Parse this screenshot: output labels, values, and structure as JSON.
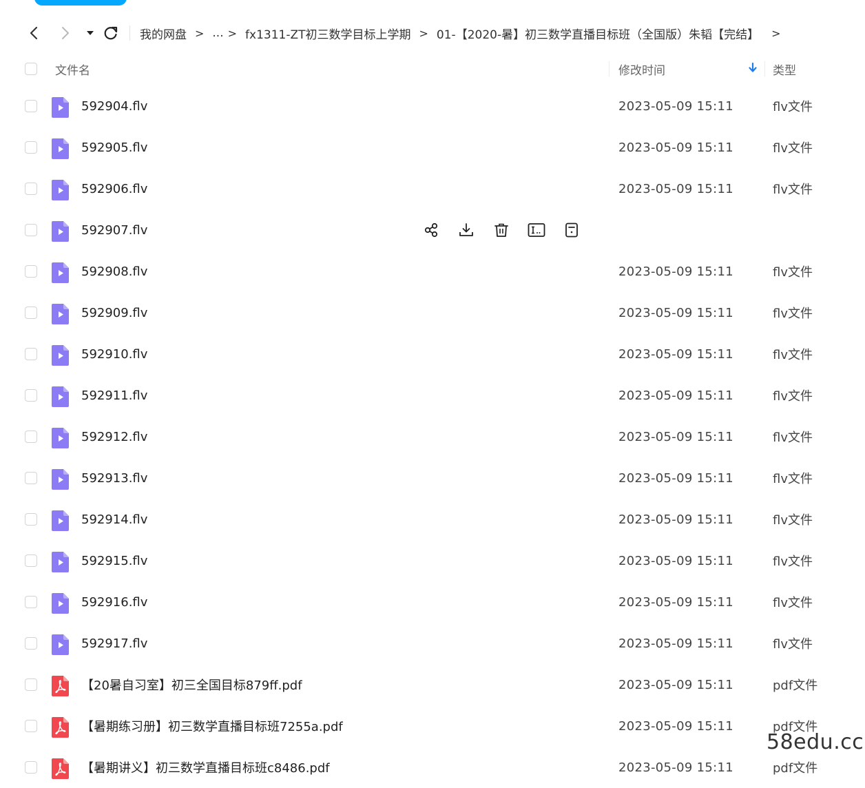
{
  "nav": {
    "breadcrumbs": [
      "我的网盘",
      "...",
      "fx1311-ZT初三数学目标上学期",
      "01-【2020-暑】初三数学直播目标班（全国版）朱韬【完结】"
    ]
  },
  "header": {
    "name_label": "文件名",
    "time_label": "修改时间",
    "type_label": "类型"
  },
  "files": [
    {
      "name": "592904.flv",
      "time": "2023-05-09 15:11",
      "type": "flv文件",
      "icon": "video-file-icon"
    },
    {
      "name": "592905.flv",
      "time": "2023-05-09 15:11",
      "type": "flv文件",
      "icon": "video-file-icon"
    },
    {
      "name": "592906.flv",
      "time": "2023-05-09 15:11",
      "type": "flv文件",
      "icon": "video-file-icon"
    },
    {
      "name": "592907.flv",
      "time": "",
      "type": "",
      "icon": "video-file-icon",
      "hovered": true
    },
    {
      "name": "592908.flv",
      "time": "2023-05-09 15:11",
      "type": "flv文件",
      "icon": "video-file-icon"
    },
    {
      "name": "592909.flv",
      "time": "2023-05-09 15:11",
      "type": "flv文件",
      "icon": "video-file-icon"
    },
    {
      "name": "592910.flv",
      "time": "2023-05-09 15:11",
      "type": "flv文件",
      "icon": "video-file-icon"
    },
    {
      "name": "592911.flv",
      "time": "2023-05-09 15:11",
      "type": "flv文件",
      "icon": "video-file-icon"
    },
    {
      "name": "592912.flv",
      "time": "2023-05-09 15:11",
      "type": "flv文件",
      "icon": "video-file-icon"
    },
    {
      "name": "592913.flv",
      "time": "2023-05-09 15:11",
      "type": "flv文件",
      "icon": "video-file-icon"
    },
    {
      "name": "592914.flv",
      "time": "2023-05-09 15:11",
      "type": "flv文件",
      "icon": "video-file-icon"
    },
    {
      "name": "592915.flv",
      "time": "2023-05-09 15:11",
      "type": "flv文件",
      "icon": "video-file-icon"
    },
    {
      "name": "592916.flv",
      "time": "2023-05-09 15:11",
      "type": "flv文件",
      "icon": "video-file-icon"
    },
    {
      "name": "592917.flv",
      "time": "2023-05-09 15:11",
      "type": "flv文件",
      "icon": "video-file-icon"
    },
    {
      "name": "【20暑自习室】初三全国目标879ff.pdf",
      "time": "2023-05-09 15:11",
      "type": "pdf文件",
      "icon": "pdf-file-icon"
    },
    {
      "name": "【暑期练习册】初三数学直播目标班7255a.pdf",
      "time": "2023-05-09 15:11",
      "type": "pdf文件",
      "icon": "pdf-file-icon"
    },
    {
      "name": "【暑期讲义】初三数学直播目标班c8486.pdf",
      "time": "2023-05-09 15:11",
      "type": "pdf文件",
      "icon": "pdf-file-icon"
    }
  ],
  "hover_actions": [
    "share-icon",
    "download-icon",
    "delete-icon",
    "rename-icon",
    "more-icon"
  ],
  "watermark": "58edu.cc",
  "colors": {
    "accent": "#06a7ff",
    "video_icon": "#8b7cf6",
    "pdf_icon": "#f0484e",
    "sort_arrow": "#1e7cf2"
  }
}
